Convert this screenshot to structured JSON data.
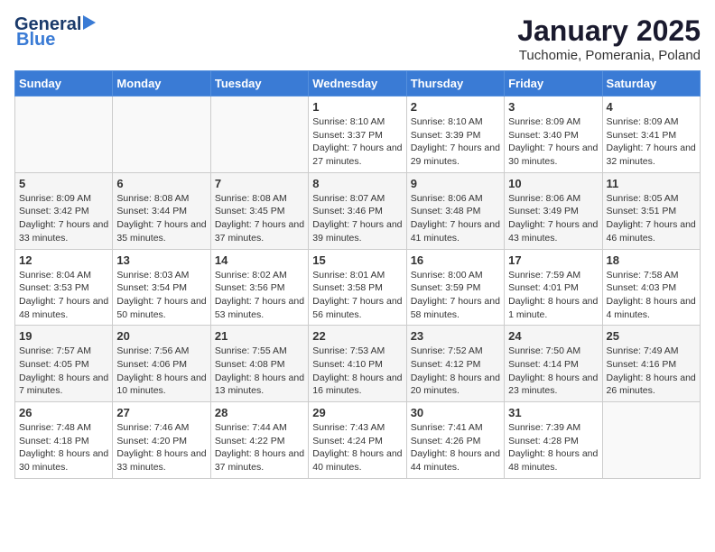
{
  "header": {
    "logo_general": "General",
    "logo_blue": "Blue",
    "title": "January 2025",
    "subtitle": "Tuchomie, Pomerania, Poland"
  },
  "days_of_week": [
    "Sunday",
    "Monday",
    "Tuesday",
    "Wednesday",
    "Thursday",
    "Friday",
    "Saturday"
  ],
  "weeks": [
    {
      "row_bg": "white",
      "days": [
        {
          "num": "",
          "info": ""
        },
        {
          "num": "",
          "info": ""
        },
        {
          "num": "",
          "info": ""
        },
        {
          "num": "1",
          "info": "Sunrise: 8:10 AM\nSunset: 3:37 PM\nDaylight: 7 hours and 27 minutes."
        },
        {
          "num": "2",
          "info": "Sunrise: 8:10 AM\nSunset: 3:39 PM\nDaylight: 7 hours and 29 minutes."
        },
        {
          "num": "3",
          "info": "Sunrise: 8:09 AM\nSunset: 3:40 PM\nDaylight: 7 hours and 30 minutes."
        },
        {
          "num": "4",
          "info": "Sunrise: 8:09 AM\nSunset: 3:41 PM\nDaylight: 7 hours and 32 minutes."
        }
      ]
    },
    {
      "row_bg": "gray",
      "days": [
        {
          "num": "5",
          "info": "Sunrise: 8:09 AM\nSunset: 3:42 PM\nDaylight: 7 hours and 33 minutes."
        },
        {
          "num": "6",
          "info": "Sunrise: 8:08 AM\nSunset: 3:44 PM\nDaylight: 7 hours and 35 minutes."
        },
        {
          "num": "7",
          "info": "Sunrise: 8:08 AM\nSunset: 3:45 PM\nDaylight: 7 hours and 37 minutes."
        },
        {
          "num": "8",
          "info": "Sunrise: 8:07 AM\nSunset: 3:46 PM\nDaylight: 7 hours and 39 minutes."
        },
        {
          "num": "9",
          "info": "Sunrise: 8:06 AM\nSunset: 3:48 PM\nDaylight: 7 hours and 41 minutes."
        },
        {
          "num": "10",
          "info": "Sunrise: 8:06 AM\nSunset: 3:49 PM\nDaylight: 7 hours and 43 minutes."
        },
        {
          "num": "11",
          "info": "Sunrise: 8:05 AM\nSunset: 3:51 PM\nDaylight: 7 hours and 46 minutes."
        }
      ]
    },
    {
      "row_bg": "white",
      "days": [
        {
          "num": "12",
          "info": "Sunrise: 8:04 AM\nSunset: 3:53 PM\nDaylight: 7 hours and 48 minutes."
        },
        {
          "num": "13",
          "info": "Sunrise: 8:03 AM\nSunset: 3:54 PM\nDaylight: 7 hours and 50 minutes."
        },
        {
          "num": "14",
          "info": "Sunrise: 8:02 AM\nSunset: 3:56 PM\nDaylight: 7 hours and 53 minutes."
        },
        {
          "num": "15",
          "info": "Sunrise: 8:01 AM\nSunset: 3:58 PM\nDaylight: 7 hours and 56 minutes."
        },
        {
          "num": "16",
          "info": "Sunrise: 8:00 AM\nSunset: 3:59 PM\nDaylight: 7 hours and 58 minutes."
        },
        {
          "num": "17",
          "info": "Sunrise: 7:59 AM\nSunset: 4:01 PM\nDaylight: 8 hours and 1 minute."
        },
        {
          "num": "18",
          "info": "Sunrise: 7:58 AM\nSunset: 4:03 PM\nDaylight: 8 hours and 4 minutes."
        }
      ]
    },
    {
      "row_bg": "gray",
      "days": [
        {
          "num": "19",
          "info": "Sunrise: 7:57 AM\nSunset: 4:05 PM\nDaylight: 8 hours and 7 minutes."
        },
        {
          "num": "20",
          "info": "Sunrise: 7:56 AM\nSunset: 4:06 PM\nDaylight: 8 hours and 10 minutes."
        },
        {
          "num": "21",
          "info": "Sunrise: 7:55 AM\nSunset: 4:08 PM\nDaylight: 8 hours and 13 minutes."
        },
        {
          "num": "22",
          "info": "Sunrise: 7:53 AM\nSunset: 4:10 PM\nDaylight: 8 hours and 16 minutes."
        },
        {
          "num": "23",
          "info": "Sunrise: 7:52 AM\nSunset: 4:12 PM\nDaylight: 8 hours and 20 minutes."
        },
        {
          "num": "24",
          "info": "Sunrise: 7:50 AM\nSunset: 4:14 PM\nDaylight: 8 hours and 23 minutes."
        },
        {
          "num": "25",
          "info": "Sunrise: 7:49 AM\nSunset: 4:16 PM\nDaylight: 8 hours and 26 minutes."
        }
      ]
    },
    {
      "row_bg": "white",
      "days": [
        {
          "num": "26",
          "info": "Sunrise: 7:48 AM\nSunset: 4:18 PM\nDaylight: 8 hours and 30 minutes."
        },
        {
          "num": "27",
          "info": "Sunrise: 7:46 AM\nSunset: 4:20 PM\nDaylight: 8 hours and 33 minutes."
        },
        {
          "num": "28",
          "info": "Sunrise: 7:44 AM\nSunset: 4:22 PM\nDaylight: 8 hours and 37 minutes."
        },
        {
          "num": "29",
          "info": "Sunrise: 7:43 AM\nSunset: 4:24 PM\nDaylight: 8 hours and 40 minutes."
        },
        {
          "num": "30",
          "info": "Sunrise: 7:41 AM\nSunset: 4:26 PM\nDaylight: 8 hours and 44 minutes."
        },
        {
          "num": "31",
          "info": "Sunrise: 7:39 AM\nSunset: 4:28 PM\nDaylight: 8 hours and 48 minutes."
        },
        {
          "num": "",
          "info": ""
        }
      ]
    }
  ]
}
